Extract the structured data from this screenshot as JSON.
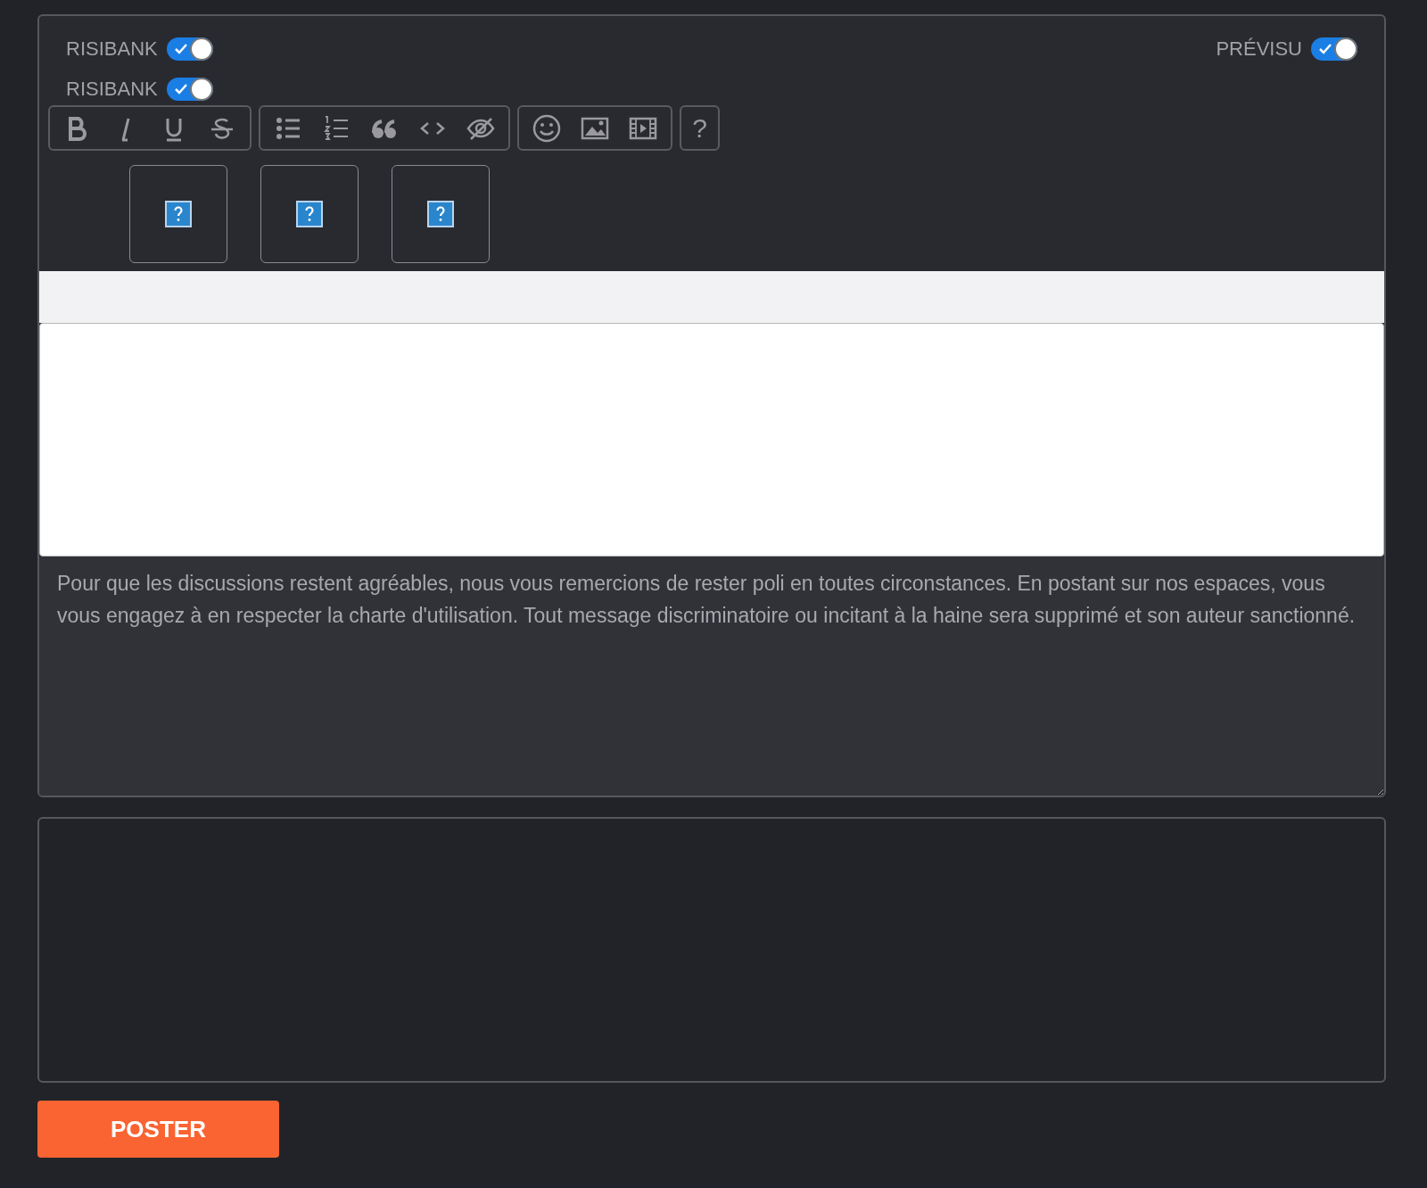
{
  "toggles": [
    {
      "label": "RISIBANK",
      "on": true
    },
    {
      "label": "RISIBANK",
      "on": true
    }
  ],
  "preview_toggle": {
    "label": "PRÉVISU",
    "on": true
  },
  "toolbar": {
    "groups": [
      [
        {
          "kind": "bold"
        },
        {
          "kind": "italic"
        },
        {
          "kind": "underline"
        },
        {
          "kind": "strike"
        }
      ],
      [
        {
          "kind": "bullets"
        },
        {
          "kind": "numbers"
        },
        {
          "kind": "quote"
        },
        {
          "kind": "code"
        },
        {
          "kind": "spoiler"
        }
      ],
      [
        {
          "kind": "emoji"
        },
        {
          "kind": "image"
        },
        {
          "kind": "video"
        }
      ]
    ],
    "help": "?"
  },
  "image_tiles": [
    {
      "kind": "broken"
    },
    {
      "kind": "broken"
    },
    {
      "kind": "broken"
    }
  ],
  "message": {
    "placeholder": "Pour que les discussions restent agréables, nous vous remercions de rester poli en toutes circonstances. En postant sur nos espaces, vous vous engagez à en respecter la charte d'utilisation. Tout message discriminatoire ou incitant à la haine sera supprimé et son auteur sanctionné."
  },
  "submit": "POSTER"
}
